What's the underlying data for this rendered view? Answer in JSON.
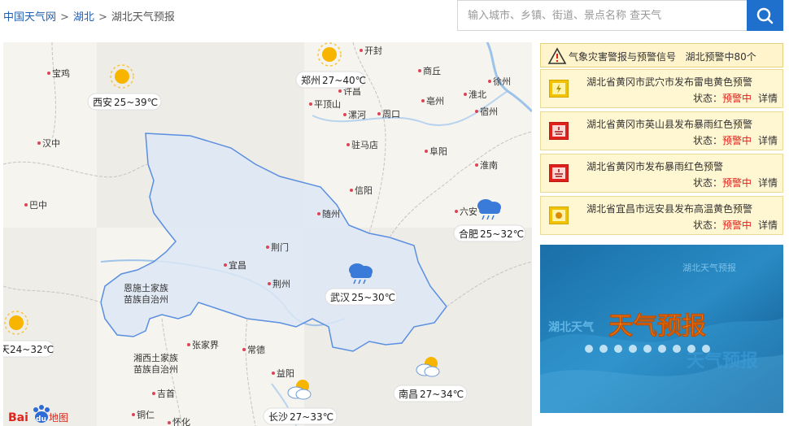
{
  "breadcrumb": {
    "home": "中国天气网",
    "region": "湖北",
    "current": "湖北天气预报",
    "sep": ">"
  },
  "search": {
    "placeholder": "输入城市、乡镇、街道、景点名称 查天气"
  },
  "map": {
    "cities": [
      "宝鸡",
      "汉中",
      "巴中",
      "开封",
      "商丘",
      "许昌",
      "平顶山",
      "漯河",
      "周口",
      "亳州",
      "淮北",
      "宿州",
      "徐州",
      "驻马店",
      "阜阳",
      "淮南",
      "信阳",
      "六安",
      "随州",
      "荆门",
      "宜昌",
      "荆州",
      "张家界",
      "常德",
      "益阳",
      "吉首",
      "铜仁",
      "怀化",
      "恩施土家族",
      "苗族自治州",
      "湘西土家族",
      "苗族自治州"
    ],
    "forecasts": [
      {
        "city": "郑州",
        "temp": "27~40℃",
        "icon": "sunny-icon"
      },
      {
        "city": "西安",
        "temp": "25~39℃",
        "icon": "sunny-icon"
      },
      {
        "city": "合肥",
        "temp": "25~32℃",
        "icon": "rain-icon"
      },
      {
        "city": "武汉",
        "temp": "25~30℃",
        "icon": "rain-icon"
      },
      {
        "city": "天",
        "temp": "24~32℃",
        "icon": "sunny-icon"
      },
      {
        "city": "南昌",
        "temp": "27~34℃",
        "icon": "partly-cloudy-icon"
      },
      {
        "city": "长沙",
        "temp": "27~33℃",
        "icon": "partly-cloudy-icon"
      }
    ],
    "logo_text": "Bai",
    "logo_text2": "du",
    "logo_suffix": "地图"
  },
  "warnings": {
    "title": "气象灾害警报与预警信号",
    "summary": "湖北预警中80个",
    "items": [
      {
        "title": "湖北省黄冈市武穴市发布雷电黄色预警",
        "status_label": "状态：",
        "status": "预警中",
        "detail": "详情",
        "color": "#f2c200"
      },
      {
        "title": "湖北省黄冈市英山县发布暴雨红色预警",
        "status_label": "状态：",
        "status": "预警中",
        "detail": "详情",
        "color": "#e0201a"
      },
      {
        "title": "湖北省黄冈市发布暴雨红色预警",
        "status_label": "状态：",
        "status": "预警中",
        "detail": "详情",
        "color": "#e0201a"
      },
      {
        "title": "湖北省宜昌市远安县发布高温黄色预警",
        "status_label": "状态：",
        "status": "预警中",
        "detail": "详情",
        "color": "#f2c200"
      }
    ]
  },
  "banner": {
    "title": "天气预报",
    "sub1": "湖北天气预报",
    "sub2": "湖北天气",
    "sub3": "天气预报"
  }
}
